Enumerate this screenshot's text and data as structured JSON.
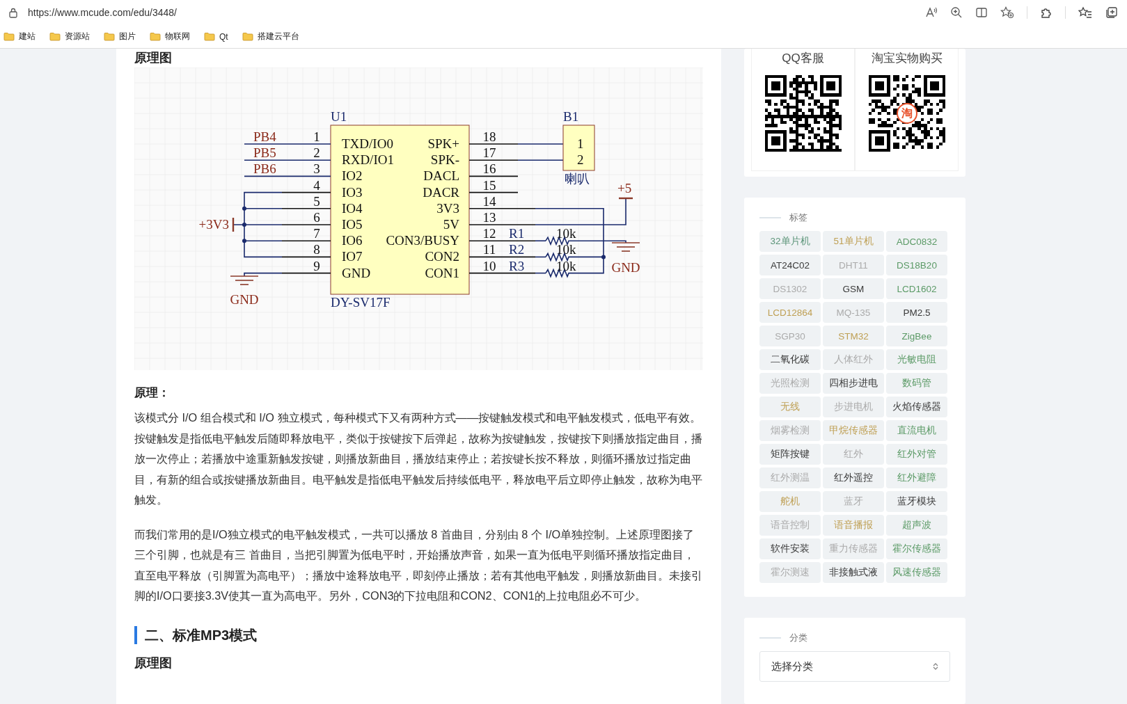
{
  "browser": {
    "url": "https://www.mcude.com/edu/3448/",
    "bookmarks": [
      "建站",
      "资源站",
      "图片",
      "物联网",
      "Qt",
      "搭建云平台"
    ]
  },
  "article": {
    "top_heading": "原理图",
    "schematic": {
      "chip": {
        "ref": "U1",
        "model": "DY-SV17F",
        "left_pins": [
          {
            "num": "1",
            "name": "TXD/IO0",
            "net": "PB4"
          },
          {
            "num": "2",
            "name": "RXD/IO1",
            "net": "PB5"
          },
          {
            "num": "3",
            "name": "IO2",
            "net": "PB6"
          },
          {
            "num": "4",
            "name": "IO3"
          },
          {
            "num": "5",
            "name": "IO4"
          },
          {
            "num": "6",
            "name": "IO5"
          },
          {
            "num": "7",
            "name": "IO6"
          },
          {
            "num": "8",
            "name": "IO7"
          },
          {
            "num": "9",
            "name": "GND"
          }
        ],
        "right_pins": [
          {
            "num": "18",
            "name": "SPK+"
          },
          {
            "num": "17",
            "name": "SPK-"
          },
          {
            "num": "16",
            "name": "DACL"
          },
          {
            "num": "15",
            "name": "DACR"
          },
          {
            "num": "14",
            "name": "3V3"
          },
          {
            "num": "13",
            "name": "5V"
          },
          {
            "num": "12",
            "name": "CON3/BUSY"
          },
          {
            "num": "11",
            "name": "CON2"
          },
          {
            "num": "10",
            "name": "CON1"
          }
        ]
      },
      "speaker": {
        "ref": "B1",
        "name": "喇叭",
        "pins": [
          "1",
          "2"
        ]
      },
      "resistors": [
        {
          "ref": "R1",
          "value": "10k"
        },
        {
          "ref": "R2",
          "value": "10k"
        },
        {
          "ref": "R3",
          "value": "10k"
        }
      ],
      "power": [
        "+3V3",
        "+5"
      ],
      "grounds": [
        "GND",
        "GND"
      ]
    },
    "section_label": "原理：",
    "paragraphs": [
      "该模式分 I/O 组合模式和 I/O 独立模式，每种模式下又有两种方式——按键触发模式和电平触发模式，低电平有效。按键触发是指低电平触发后随即释放电平，类似于按键按下后弹起，故称为按键触发，按键按下则播放指定曲目，播放一次停止；若播放中途重新触发按键，则播放新曲目，播放结束停止；若按键长按不释放，则循环播放过指定曲目，有新的组合或按键播放新曲目。电平触发是指低电平触发后持续低电平，释放电平后立即停止触发，故称为电平触发。",
      "而我们常用的是I/O独立模式的电平触发模式，一共可以播放 8 首曲目，分别由 8 个 I/O单独控制。上述原理图接了三个引脚，也就是有三 首曲目，当把引脚置为低电平时，开始播放声音，如果一直为低电平则循环播放指定曲目，直至电平释放（引脚置为高电平）；播放中途释放电平，即刻停止播放；若有其他电平触发，则播放新曲目。未接引脚的I/O口要接3.3V使其一直为高电平。另外，CON3的下拉电阻和CON2、CON1的上拉电阻必不可少。"
    ],
    "section_heading": "二、标准MP3模式",
    "bottom_heading": "原理图"
  },
  "sidebar": {
    "qr_codes": [
      {
        "title": "QQ客服"
      },
      {
        "title": "淘宝实物购买",
        "badge": "淘"
      }
    ],
    "tags_title": "标签",
    "tags": [
      {
        "label": "32单片机",
        "color": "#5b9478"
      },
      {
        "label": "51单片机",
        "color": "#bfa055"
      },
      {
        "label": "ADC0832",
        "color": "#5b9a66"
      },
      {
        "label": "AT24C02",
        "color": "#3a3a3a"
      },
      {
        "label": "DHT11",
        "color": "#ababab"
      },
      {
        "label": "DS18B20",
        "color": "#5b9a66"
      },
      {
        "label": "DS1302",
        "color": "#ababab"
      },
      {
        "label": "GSM",
        "color": "#3a3a3a"
      },
      {
        "label": "LCD1602",
        "color": "#5b9a66"
      },
      {
        "label": "LCD12864",
        "color": "#bfa055"
      },
      {
        "label": "MQ-135",
        "color": "#ababab"
      },
      {
        "label": "PM2.5",
        "color": "#3a3a3a"
      },
      {
        "label": "SGP30",
        "color": "#ababab"
      },
      {
        "label": "STM32",
        "color": "#bfa055"
      },
      {
        "label": "ZigBee",
        "color": "#5b9a66"
      },
      {
        "label": "二氧化碳",
        "color": "#3a3a3a"
      },
      {
        "label": "人体红外",
        "color": "#ababab"
      },
      {
        "label": "光敏电阻",
        "color": "#5b9a66"
      },
      {
        "label": "光照检测",
        "color": "#ababab"
      },
      {
        "label": "四相步进电",
        "color": "#3a3a3a"
      },
      {
        "label": "数码管",
        "color": "#5b9a66"
      },
      {
        "label": "无线",
        "color": "#bfa055"
      },
      {
        "label": "步进电机",
        "color": "#ababab"
      },
      {
        "label": "火焰传感器",
        "color": "#3a3a3a"
      },
      {
        "label": "烟雾检测",
        "color": "#ababab"
      },
      {
        "label": "甲烷传感器",
        "color": "#bfa055"
      },
      {
        "label": "直流电机",
        "color": "#5b9a66"
      },
      {
        "label": "矩阵按键",
        "color": "#3a3a3a"
      },
      {
        "label": "红外",
        "color": "#ababab"
      },
      {
        "label": "红外对管",
        "color": "#5b9a66"
      },
      {
        "label": "红外测温",
        "color": "#ababab"
      },
      {
        "label": "红外遥控",
        "color": "#3a3a3a"
      },
      {
        "label": "红外避障",
        "color": "#5b9a66"
      },
      {
        "label": "舵机",
        "color": "#bfa055"
      },
      {
        "label": "蓝牙",
        "color": "#ababab"
      },
      {
        "label": "蓝牙模块",
        "color": "#3a3a3a"
      },
      {
        "label": "语音控制",
        "color": "#ababab"
      },
      {
        "label": "语音播报",
        "color": "#bfa055"
      },
      {
        "label": "超声波",
        "color": "#5b9a66"
      },
      {
        "label": "软件安装",
        "color": "#3a3a3a"
      },
      {
        "label": "重力传感器",
        "color": "#ababab"
      },
      {
        "label": "霍尔传感器",
        "color": "#5b9a66"
      },
      {
        "label": "霍尔测速",
        "color": "#ababab"
      },
      {
        "label": "非接触式液",
        "color": "#3a3a3a"
      },
      {
        "label": "风速传感器",
        "color": "#5b9a66"
      }
    ],
    "category_title": "分类",
    "category_select": {
      "value": "选择分类"
    }
  }
}
